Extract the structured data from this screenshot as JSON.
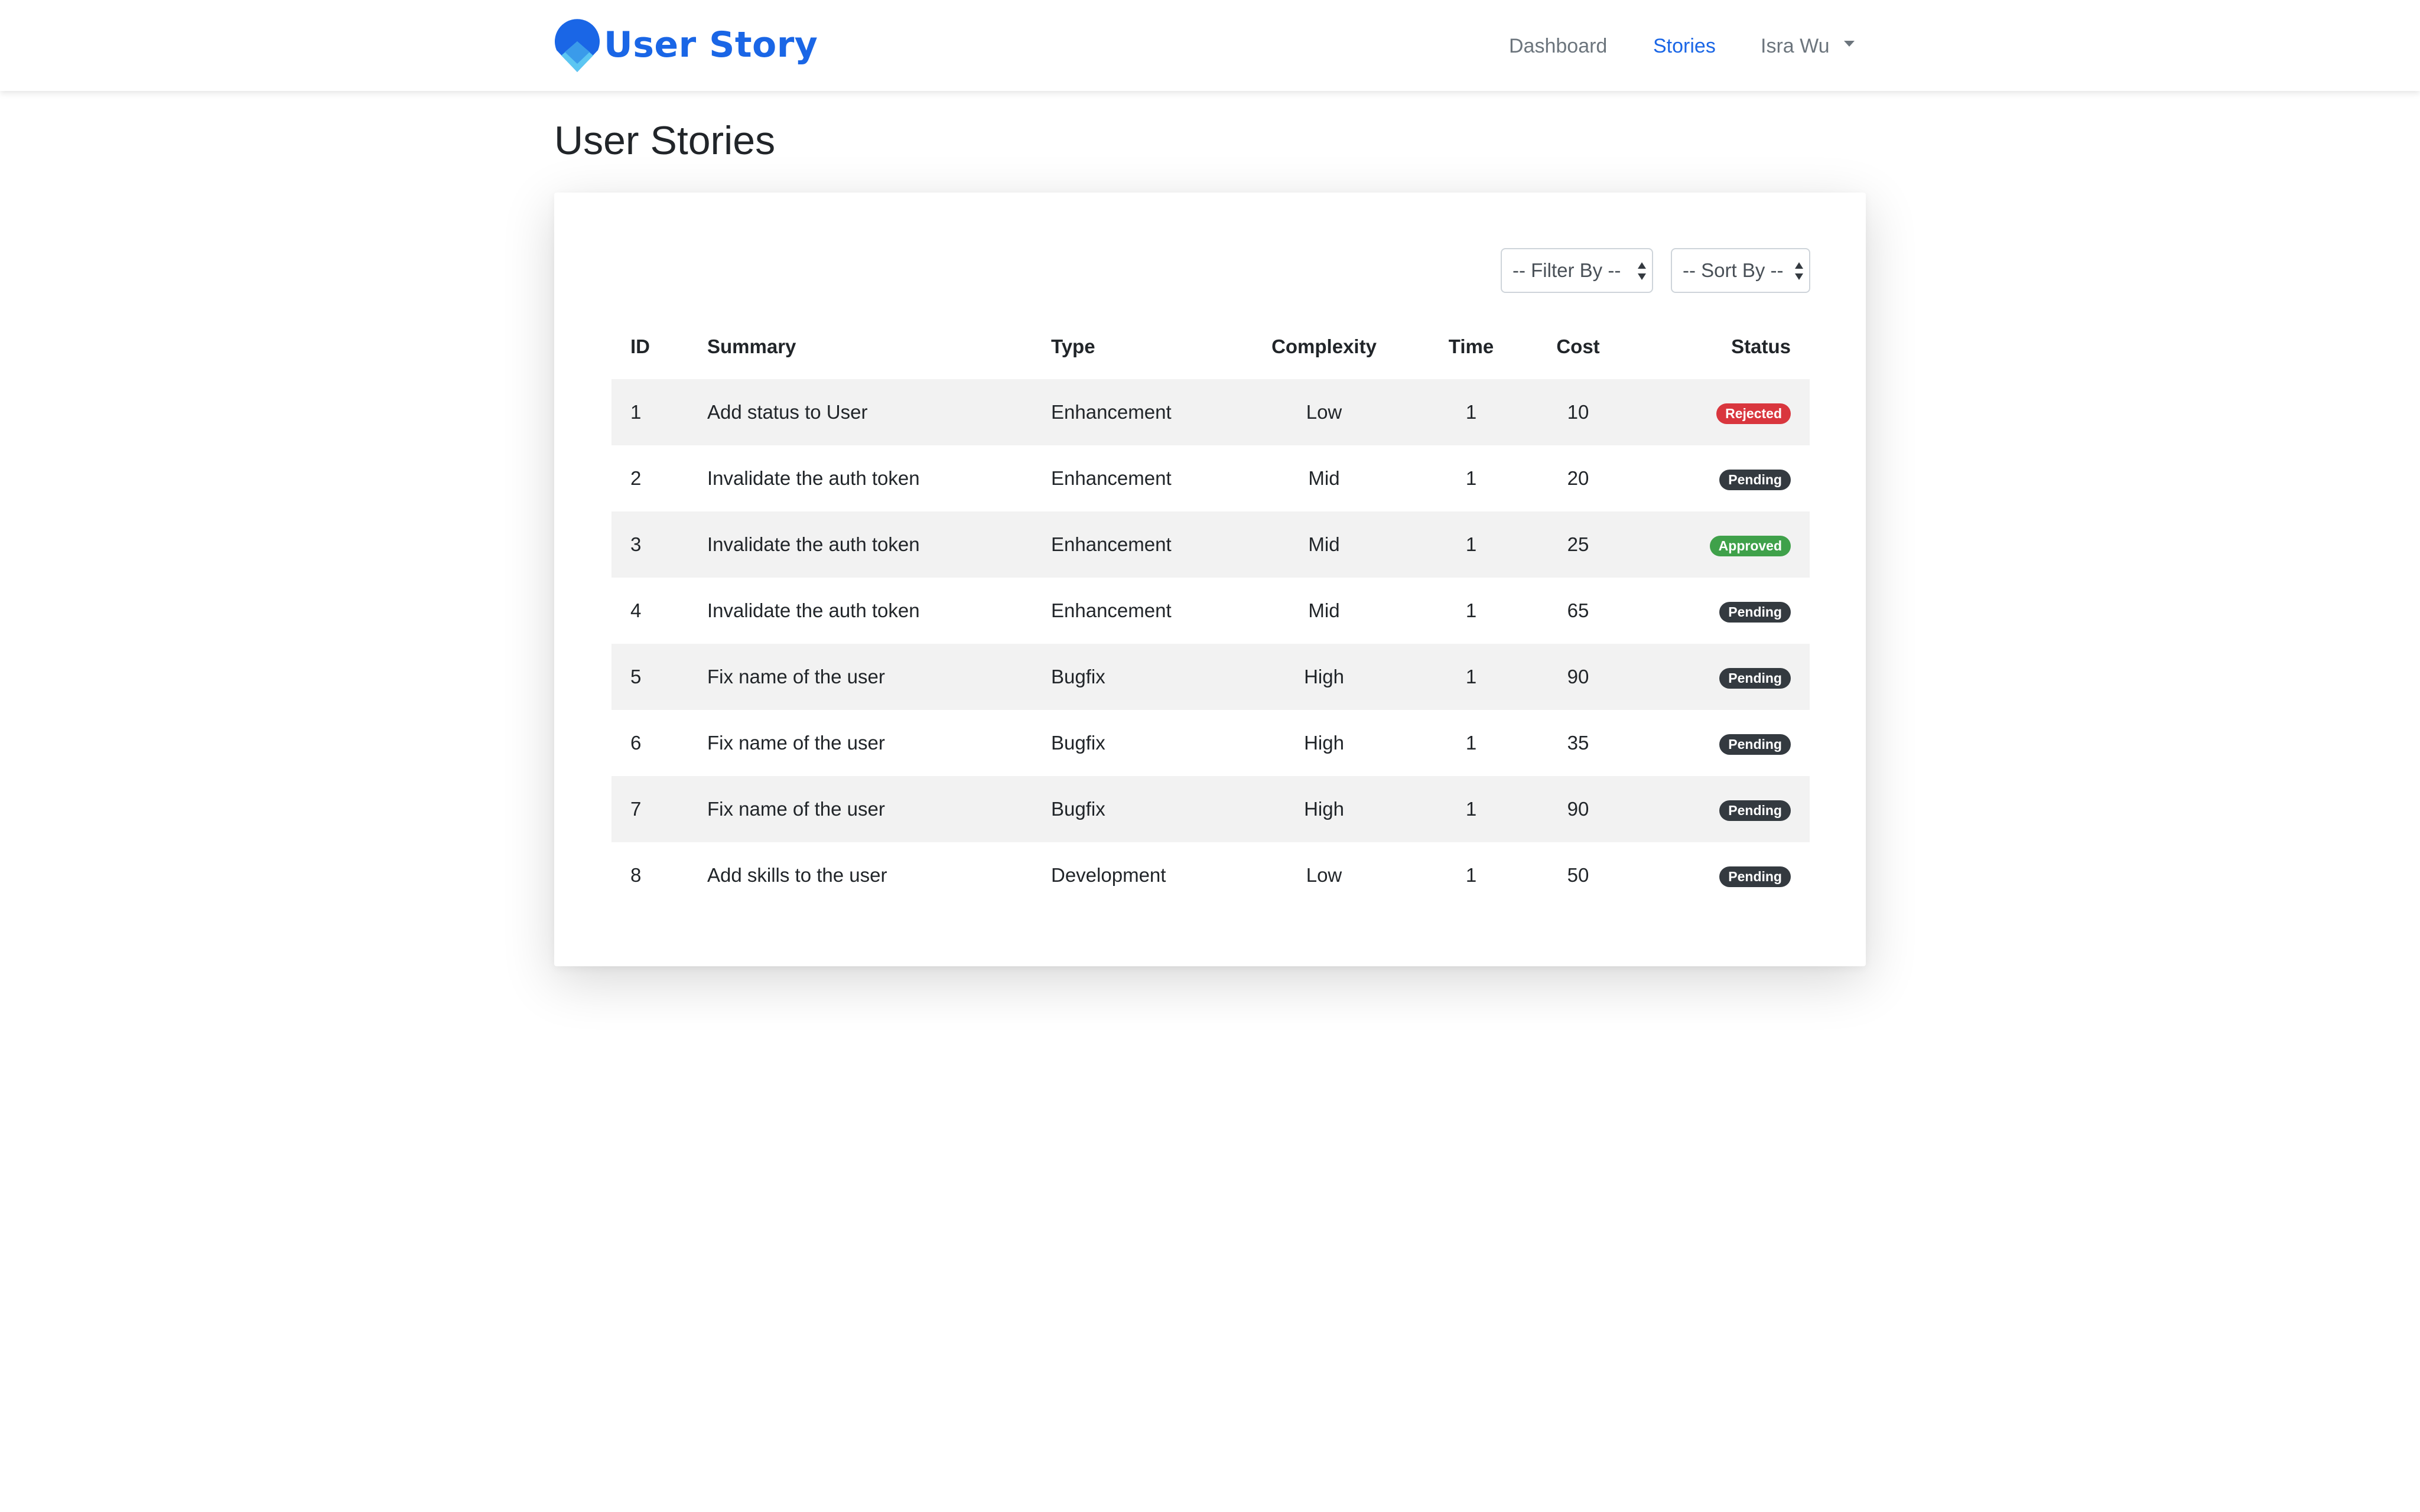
{
  "brand": {
    "name": "User Story",
    "logo_icon": "map-pin-logo-icon",
    "color": "#1a66e6"
  },
  "nav": {
    "dashboard": "Dashboard",
    "stories": "Stories",
    "user": "Isra Wu"
  },
  "page": {
    "title": "User Stories"
  },
  "filters": {
    "filter_by": "-- Filter By --",
    "sort_by": "-- Sort By --"
  },
  "table": {
    "columns": [
      "ID",
      "Summary",
      "Type",
      "Complexity",
      "Time",
      "Cost",
      "Status"
    ],
    "rows": [
      {
        "id": "1",
        "summary": "Add status to User",
        "type": "Enhancement",
        "complexity": "Low",
        "time": "1",
        "cost": "10",
        "status": "Rejected",
        "status_color": "#d9363e"
      },
      {
        "id": "2",
        "summary": "Invalidate the auth token",
        "type": "Enhancement",
        "complexity": "Mid",
        "time": "1",
        "cost": "20",
        "status": "Pending",
        "status_color": "#343a40"
      },
      {
        "id": "3",
        "summary": "Invalidate the auth token",
        "type": "Enhancement",
        "complexity": "Mid",
        "time": "1",
        "cost": "25",
        "status": "Approved",
        "status_color": "#3fa14a"
      },
      {
        "id": "4",
        "summary": "Invalidate the auth token",
        "type": "Enhancement",
        "complexity": "Mid",
        "time": "1",
        "cost": "65",
        "status": "Pending",
        "status_color": "#343a40"
      },
      {
        "id": "5",
        "summary": "Fix name of the user",
        "type": "Bugfix",
        "complexity": "High",
        "time": "1",
        "cost": "90",
        "status": "Pending",
        "status_color": "#343a40"
      },
      {
        "id": "6",
        "summary": "Fix name of the user",
        "type": "Bugfix",
        "complexity": "High",
        "time": "1",
        "cost": "35",
        "status": "Pending",
        "status_color": "#343a40"
      },
      {
        "id": "7",
        "summary": "Fix name of the user",
        "type": "Bugfix",
        "complexity": "High",
        "time": "1",
        "cost": "90",
        "status": "Pending",
        "status_color": "#343a40"
      },
      {
        "id": "8",
        "summary": "Add skills to the user",
        "type": "Development",
        "complexity": "Low",
        "time": "1",
        "cost": "50",
        "status": "Pending",
        "status_color": "#343a40"
      }
    ]
  }
}
